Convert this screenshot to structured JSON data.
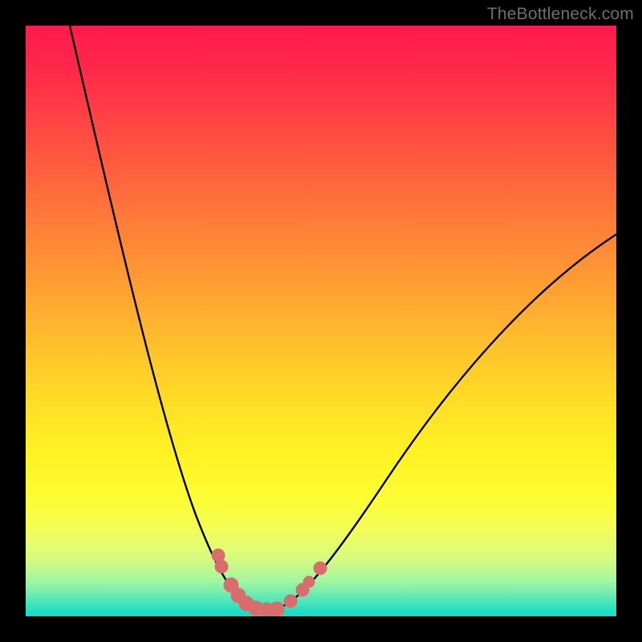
{
  "watermark": "TheBottleneck.com",
  "chart_data": {
    "type": "line",
    "title": "",
    "xlabel": "",
    "ylabel": "",
    "xlim": [
      0,
      100
    ],
    "ylim": [
      0,
      100
    ],
    "background_gradient": {
      "top_color": "#ff1a4d",
      "bottom_color": "#14d9ca",
      "meaning": "red=high bottleneck, green=low bottleneck"
    },
    "series": [
      {
        "name": "bottleneck-curve",
        "x": [
          7,
          12,
          18,
          24,
          29,
          32,
          35,
          38,
          41,
          44,
          48,
          55,
          65,
          80,
          100
        ],
        "y": [
          100,
          75,
          50,
          30,
          16,
          10,
          5,
          2,
          1,
          2,
          6,
          15,
          30,
          50,
          65
        ],
        "color": "#000000"
      },
      {
        "name": "highlighted-points",
        "x": [
          32.5,
          33,
          34.5,
          36,
          37.5,
          39,
          41,
          42.5,
          45,
          47,
          48,
          50
        ],
        "y": [
          10,
          8.5,
          5.5,
          3.5,
          2,
          1.2,
          1,
          1.2,
          2.5,
          4.5,
          5.5,
          8
        ],
        "color": "#d96d6d",
        "style": "markers"
      }
    ],
    "annotations": [
      {
        "text": "TheBottleneck.com",
        "role": "watermark",
        "position": "top-right"
      }
    ]
  }
}
